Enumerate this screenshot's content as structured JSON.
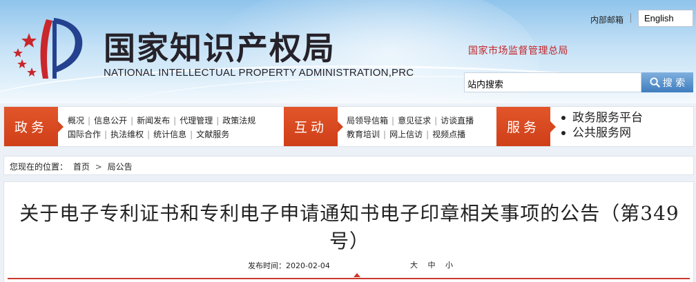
{
  "header": {
    "logo_cn": "国家知识产权局",
    "logo_en": "NATIONAL INTELLECTUAL PROPERTY ADMINISTRATION,PRC",
    "mail_link": "内部邮箱",
    "language": "English",
    "parent_org": "国家市场监督管理总局",
    "search_placeholder": "站内搜索",
    "search_button": "搜 索",
    "colors": {
      "emblem_red": "#c9272c",
      "emblem_blue": "#24418f",
      "accent": "#dc4b21"
    }
  },
  "nav": {
    "sections": [
      {
        "tab": "政务",
        "rows": [
          [
            "概况",
            "信息公开",
            "新闻发布",
            "代理管理",
            "政策法规"
          ],
          [
            "国际合作",
            "执法维权",
            "统计信息",
            "文献服务"
          ]
        ]
      },
      {
        "tab": "互动",
        "rows": [
          [
            "局领导信箱",
            "意见征求",
            "访谈直播"
          ],
          [
            "教育培训",
            "网上信访",
            "视频点播"
          ]
        ]
      },
      {
        "tab": "服务",
        "items": [
          "政务服务平台",
          "公共服务网"
        ]
      }
    ]
  },
  "breadcrumb": {
    "prefix": "您现在的位置：",
    "items": [
      "首页",
      "局公告"
    ]
  },
  "article": {
    "title": "关于电子专利证书和专利电子申请通知书电子印章相关事项的公告（第349号）",
    "published_label": "发布时间：",
    "published_date": "2020-02-04",
    "font_sizes": [
      "大",
      "中",
      "小"
    ]
  }
}
